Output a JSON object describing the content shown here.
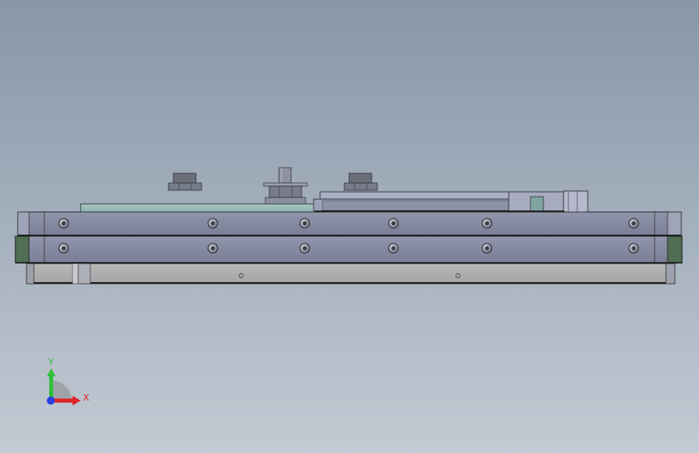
{
  "viewport": {
    "background_top": "#8896a8",
    "background_bottom": "#c2cad3"
  },
  "triad": {
    "x_label": "X",
    "y_label": "Y",
    "x_color": "#e0232a",
    "y_color": "#2fbf3a",
    "z_color": "#2a3fe0"
  }
}
